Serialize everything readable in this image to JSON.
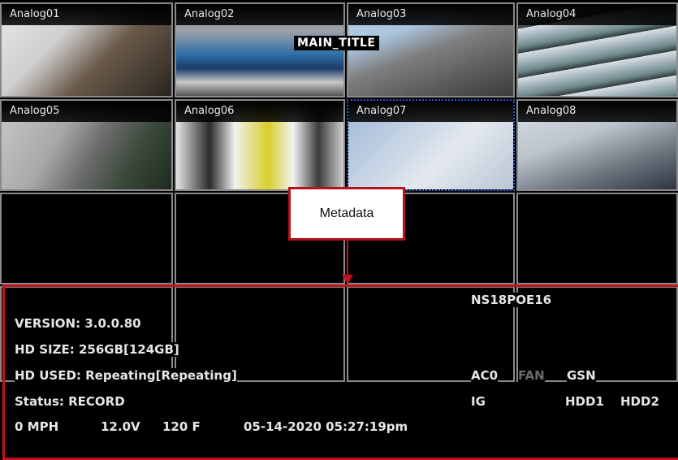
{
  "main_title": "MAIN_TITLE",
  "cameras": [
    {
      "label": "Analog01"
    },
    {
      "label": "Analog02"
    },
    {
      "label": "Analog03"
    },
    {
      "label": "Analog04"
    },
    {
      "label": "Analog05"
    },
    {
      "label": "Analog06"
    },
    {
      "label": "Analog07"
    },
    {
      "label": "Analog08"
    }
  ],
  "callout": {
    "text": "Metadata"
  },
  "device_name": "NS18POE16",
  "metadata": {
    "version": "VERSION: 3.0.0.80",
    "hd_size": "HD SIZE: 256GB[124GB]",
    "hd_used": "HD USED: Repeating[Repeating]",
    "status": "Status: RECORD",
    "speed": "0 MPH",
    "voltage": "12.0V",
    "temperature": "120 F",
    "datetime": "05-14-2020 05:27:19pm",
    "indicators": {
      "ac0": "AC0",
      "fan": "FAN",
      "gsn": "GSN",
      "ig": "IG",
      "hdd1": "HDD1",
      "hdd2": "HDD2"
    }
  },
  "colors": {
    "highlight": "#c0141c",
    "selected_border": "#2d5bd6"
  }
}
